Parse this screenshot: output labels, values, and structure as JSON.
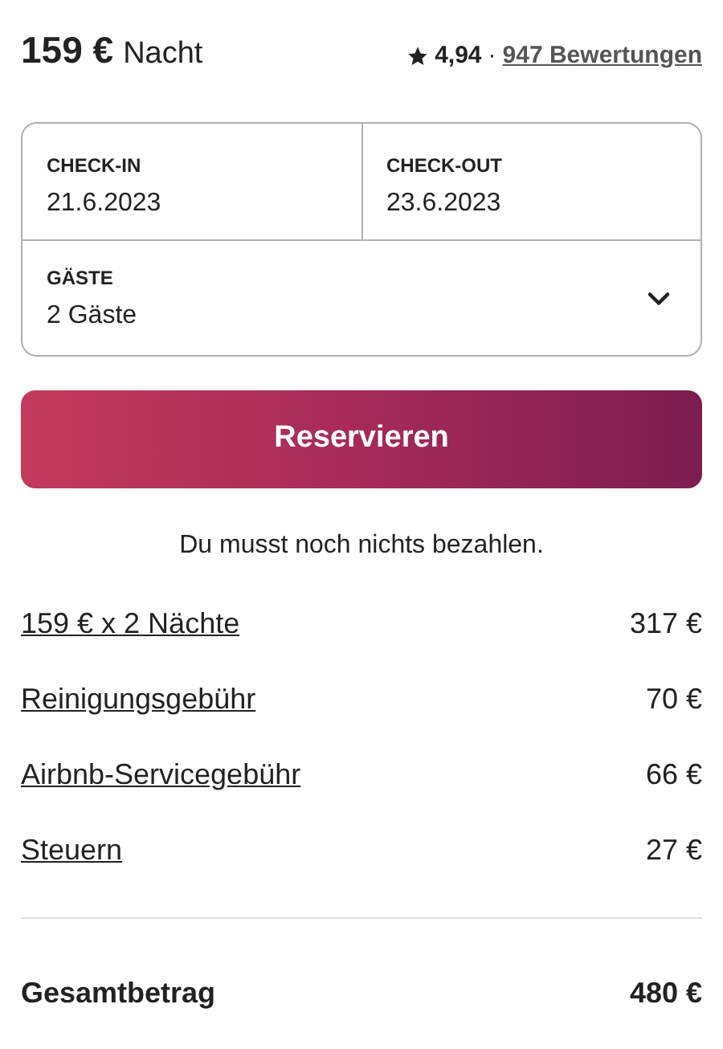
{
  "price": {
    "amount": "159 €",
    "unit": "Nacht"
  },
  "rating": {
    "score": "4,94",
    "separator": "·",
    "reviews": "947 Bewertungen"
  },
  "booking": {
    "checkin": {
      "label": "CHECK-IN",
      "value": "21.6.2023"
    },
    "checkout": {
      "label": "CHECK-OUT",
      "value": "23.6.2023"
    },
    "guests": {
      "label": "GÄSTE",
      "value": "2 Gäste",
      "expanded": false
    }
  },
  "reserve_button": "Reservieren",
  "note": "Du musst noch nichts bezahlen.",
  "fees": [
    {
      "label": "159 € x 2 Nächte",
      "amount": "317 €"
    },
    {
      "label": "Reinigungsgebühr",
      "amount": "70 €"
    },
    {
      "label": "Airbnb-Servicegebühr",
      "amount": "66 €"
    },
    {
      "label": "Steuern",
      "amount": "27 €"
    }
  ],
  "total": {
    "label": "Gesamtbetrag",
    "amount": "480 €"
  }
}
